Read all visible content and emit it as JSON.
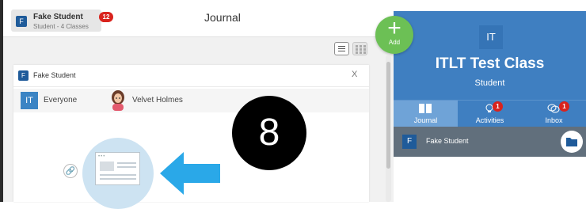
{
  "topbar": {
    "user_initial": "F",
    "user_name": "Fake Student",
    "user_sub": "Student - 4 Classes",
    "notification_count": "12",
    "page_title": "Journal"
  },
  "post_card": {
    "author_initial": "F",
    "author_name": "Fake Student",
    "close_label": "X",
    "recipient_group_initials": "IT",
    "recipient_group": "Everyone",
    "recipient_teacher": "Velvet Holmes"
  },
  "step_number": "8",
  "add_button": {
    "symbol": "+",
    "label": "Add"
  },
  "class_panel": {
    "class_initials": "IT",
    "class_name": "ITLT Test Class",
    "role": "Student",
    "tabs": [
      {
        "label": "Journal",
        "icon": "journal-icon",
        "badge": null,
        "active": true
      },
      {
        "label": "Activities",
        "icon": "lightbulb-icon",
        "badge": "1",
        "active": false
      },
      {
        "label": "Inbox",
        "icon": "chat-bubbles-icon",
        "badge": "1",
        "active": false
      }
    ],
    "student_initial": "F",
    "student_name": "Fake Student"
  },
  "colors": {
    "brand_blue": "#3f7fc1",
    "add_green": "#6cc055",
    "badge_red": "#d9231d",
    "arrow_blue": "#2aa8e8"
  }
}
